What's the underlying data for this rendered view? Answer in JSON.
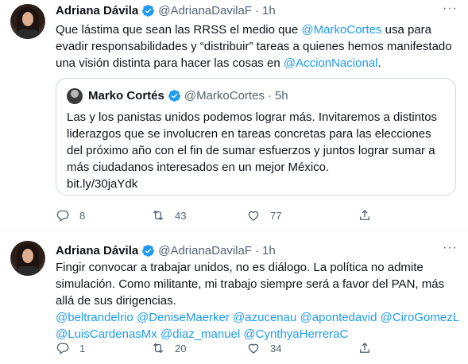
{
  "tweet1": {
    "name": "Adriana Dávila",
    "handle": "@AdrianaDavilaF",
    "dot": "·",
    "time": "1h",
    "text_pre": "Que lástima que sean las RRSS el medio que ",
    "mention1": "@MarkoCortes",
    "text_mid": " usa para evadir responsabilidades y “distribuir” tareas a quienes hemos manifestado una visión distinta para hacer las cosas en ",
    "mention2": "@AccionNacional",
    "text_end": ".",
    "quote": {
      "name": "Marko Cortés",
      "handle": "@MarkoCortes",
      "dot": "·",
      "time": "5h",
      "text": "Las y los panistas unidos podemos lograr más. Invitaremos a distintos liderazgos que se involucren en tareas concretas para las elecciones del próximo año con el fin de sumar esfuerzos y juntos lograr sumar a más ciudadanos interesados en un mejor México.",
      "link": "bit.ly/30jaYdk"
    },
    "replies": "8",
    "retweets": "43",
    "likes": "77"
  },
  "tweet2": {
    "name": "Adriana Dávila",
    "handle": "@AdrianaDavilaF",
    "dot": "·",
    "time": "1h",
    "text": "Fingir convocar a trabajar unidos, no es diálogo. La política no admite simulación. Como militante, mi trabajo siempre será a favor del PAN, más allá de sus dirigencias.",
    "mentions_line1": "@beltrandelrio @DeniseMaerker @azucenau @apontedavid @CiroGomezL",
    "mentions_line2": "@LuisCardenasMx @diaz_manuel @CynthyaHerreraC",
    "replies": "1",
    "retweets": "20",
    "likes": "34"
  },
  "icons": {
    "verified": "verified-badge-icon",
    "more": "more-dots-icon",
    "reply": "reply-icon",
    "retweet": "retweet-icon",
    "like": "heart-icon",
    "share": "share-icon"
  },
  "colors": {
    "link": "#1d9bf0",
    "secondary_text": "#536471",
    "primary_text": "#0f1419",
    "verified": "#1d9bf0",
    "border": "#cfd9de"
  }
}
